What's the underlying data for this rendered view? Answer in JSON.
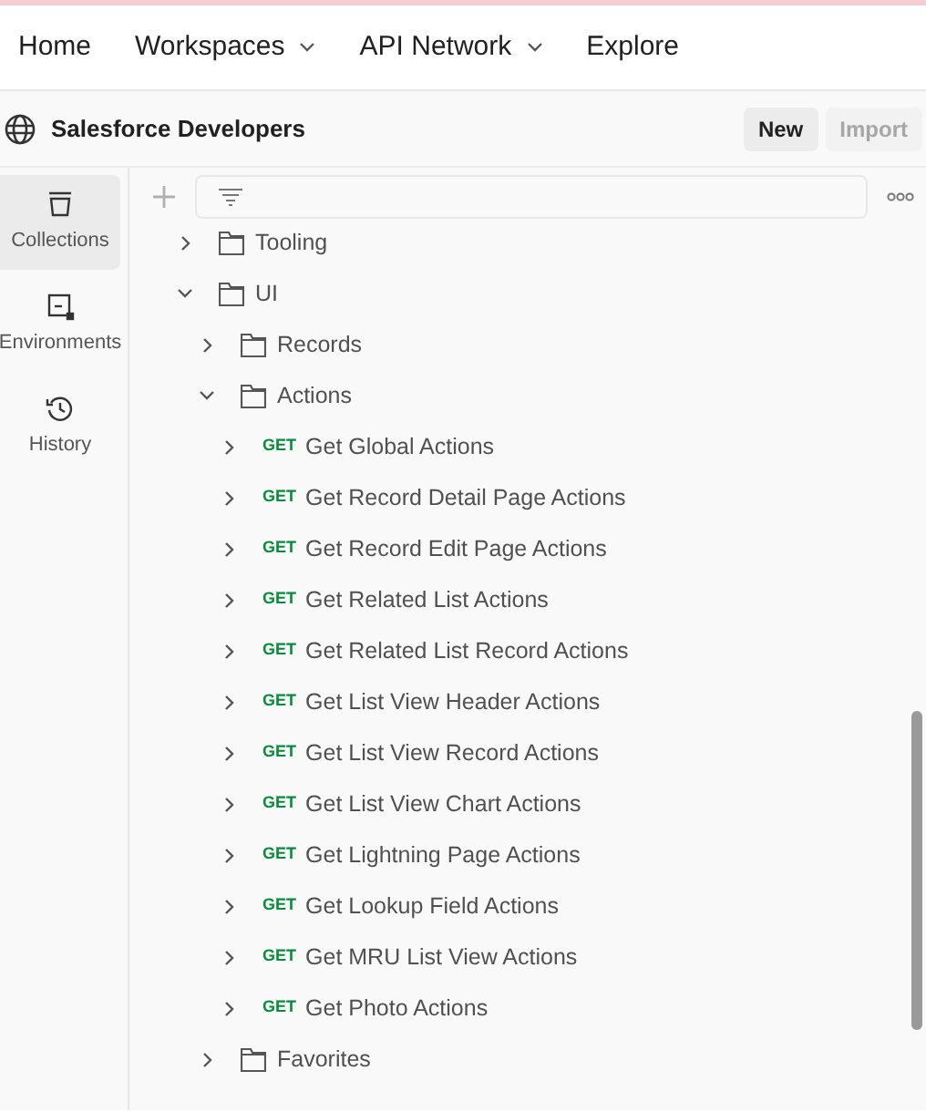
{
  "nav": [
    {
      "label": "Home",
      "dropdown": false
    },
    {
      "label": "Workspaces",
      "dropdown": true
    },
    {
      "label": "API Network",
      "dropdown": true
    },
    {
      "label": "Explore",
      "dropdown": false
    }
  ],
  "workspace": {
    "title": "Salesforce Developers",
    "buttons": [
      {
        "label": "New",
        "disabled": false
      },
      {
        "label": "Import",
        "disabled": true
      }
    ]
  },
  "sidebar": {
    "items": [
      {
        "label": "Collections",
        "kind": "collections",
        "selected": true
      },
      {
        "label": "Environments",
        "kind": "environments",
        "selected": false
      },
      {
        "label": "History",
        "kind": "history",
        "selected": false
      }
    ]
  },
  "tree": [
    {
      "kind": "folder",
      "label": "Tooling",
      "expanded": false
    },
    {
      "kind": "folder",
      "label": "UI",
      "expanded": true,
      "children": [
        {
          "kind": "folder",
          "label": "Records",
          "expanded": false
        },
        {
          "kind": "folder",
          "label": "Actions",
          "expanded": true,
          "children": [
            {
              "kind": "request",
              "method": "GET",
              "label": "Get Global Actions",
              "expanded": false
            },
            {
              "kind": "request",
              "method": "GET",
              "label": "Get Record Detail Page Actions",
              "expanded": false
            },
            {
              "kind": "request",
              "method": "GET",
              "label": "Get Record Edit Page Actions",
              "expanded": false
            },
            {
              "kind": "request",
              "method": "GET",
              "label": "Get Related List Actions",
              "expanded": false
            },
            {
              "kind": "request",
              "method": "GET",
              "label": "Get Related List Record Actions",
              "expanded": false
            },
            {
              "kind": "request",
              "method": "GET",
              "label": "Get List View Header Actions",
              "expanded": false
            },
            {
              "kind": "request",
              "method": "GET",
              "label": "Get List View Record Actions",
              "expanded": false
            },
            {
              "kind": "request",
              "method": "GET",
              "label": "Get List View Chart Actions",
              "expanded": false
            },
            {
              "kind": "request",
              "method": "GET",
              "label": "Get Lightning Page Actions",
              "expanded": false
            },
            {
              "kind": "request",
              "method": "GET",
              "label": "Get Lookup Field Actions",
              "expanded": false
            },
            {
              "kind": "request",
              "method": "GET",
              "label": "Get MRU List View Actions",
              "expanded": false
            },
            {
              "kind": "request",
              "method": "GET",
              "label": "Get Photo Actions",
              "expanded": false
            }
          ]
        },
        {
          "kind": "folder",
          "label": "Favorites",
          "expanded": false
        }
      ]
    }
  ]
}
